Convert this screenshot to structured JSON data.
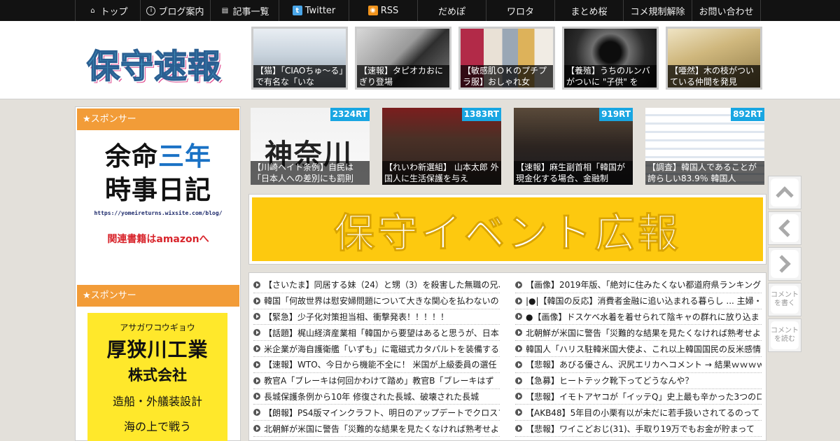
{
  "nav": {
    "items": [
      {
        "icon": "home-icon",
        "label": "トップ"
      },
      {
        "icon": "info-icon",
        "label": "ブログ案内"
      },
      {
        "icon": "list-icon",
        "label": "記事一覧"
      },
      {
        "icon": "twitter-icon",
        "label": "Twitter"
      },
      {
        "icon": "rss-icon",
        "label": "RSS"
      },
      {
        "label": "だめぽ"
      },
      {
        "label": "ワロタ"
      },
      {
        "label": "まとめ桜"
      },
      {
        "label": "コメ規制解除"
      },
      {
        "label": "お問い合わせ"
      }
    ]
  },
  "header": {
    "logo_text": "保守速報",
    "thumbs": [
      {
        "caption": "【猫】「CIAOちゅ〜る」で有名な「いな"
      },
      {
        "caption": "【速報】タピオカおにぎり登場"
      },
      {
        "caption": "【敏感肌ＯＫのプチプラ服】おしゃれ女"
      },
      {
        "caption": "【養殖】うちのルンバがついに \"子供\" を"
      },
      {
        "caption": "【唖然】木の枝がついている仲間を発見"
      }
    ]
  },
  "sidebar": {
    "sponsor_label": "★スポンサー",
    "ad1": {
      "line1_a": "余命",
      "line1_b": "三年",
      "line2": "時事日記",
      "url": "https://yomeireturns.wixsite.com/blog/",
      "amazon": "関連書籍はamazonへ"
    },
    "ad2": {
      "kana": "アサガワコウギョウ",
      "name": "厚狭川工業",
      "corp": "株式会社",
      "desc": "造船・外艤装設計",
      "extra": "海の上で戦う"
    }
  },
  "ranking": [
    {
      "rt": "2324RT",
      "caption": "【川崎ヘイト条例】自民は「日本人への差別にも罰則"
    },
    {
      "rt": "1383RT",
      "caption": "【れいわ新選組】 山本太郎 外国人に生活保護を与え"
    },
    {
      "rt": "919RT",
      "caption": "【速報】麻生副首相「韓国が現金化する場合、金融制"
    },
    {
      "rt": "892RT",
      "caption": "【調査】韓国人であることが誇らしい83.9％ 韓国人"
    }
  ],
  "banner": {
    "text": "保守イベント広報"
  },
  "news": {
    "left": [
      "【さいたま】同居する妹（24）と甥（3）を殺害した無職の兄、",
      "韓国「何故世界は慰安婦問題について大きな関心を払わないの",
      "【緊急】少子化対策担当相、衝撃発表！！！！！",
      "【話題】梶山経済産業相「韓国から要望はあると思うが、日本",
      "米企業が海自護衛艦「いずも」に電磁式カタパルトを装備する改",
      "【速報】WTO、今日から機能不全に！ 米国が上級委員の選任",
      "教官A「ブレーキは何回かわけて踏め」教官B「ブレーキはず",
      "長城保護条例から10年 修復された長城、破壊された長城",
      "【朗報】PS4版マインクラフト、明日のアップデートでクロスプ",
      "北朝鮮が米国に警告「災難的な結果を見たくなければ熟考せよ"
    ],
    "right": [
      "【画像】2019年版、「絶対に住みたくない都道府県ランキング",
      "|●|【韓国の反応】消費者金融に追い込まれる暮らし ... 主婦・高",
      "●【画像】ドスケベ水着を着せられて陰キャの群れに放り込ま",
      "北朝鮮が米国に警告「災難的な結果を見たくなければ熟考せよ",
      "韓国人「ハリス駐韓米国大使よ、これ以上韓国国民の反米感情",
      "【悲報】あびる優さん、沢尻エリカへコメント → 結果ｗｗｗｗ",
      "【急募】ヒートテック靴下ってどうなんや？",
      "【悲報】イモトアヤコが「イッテQ」史上最も辛かった3つのロ",
      "【AKB48】5年目の小栗有以が未だに若手扱いされてるのって",
      "【悲報】ワイこどおじ(31)、手取り19万でもお金が貯まって"
    ]
  },
  "side_buttons": {
    "write": "コメントを書く",
    "read": "コメントを読む"
  }
}
